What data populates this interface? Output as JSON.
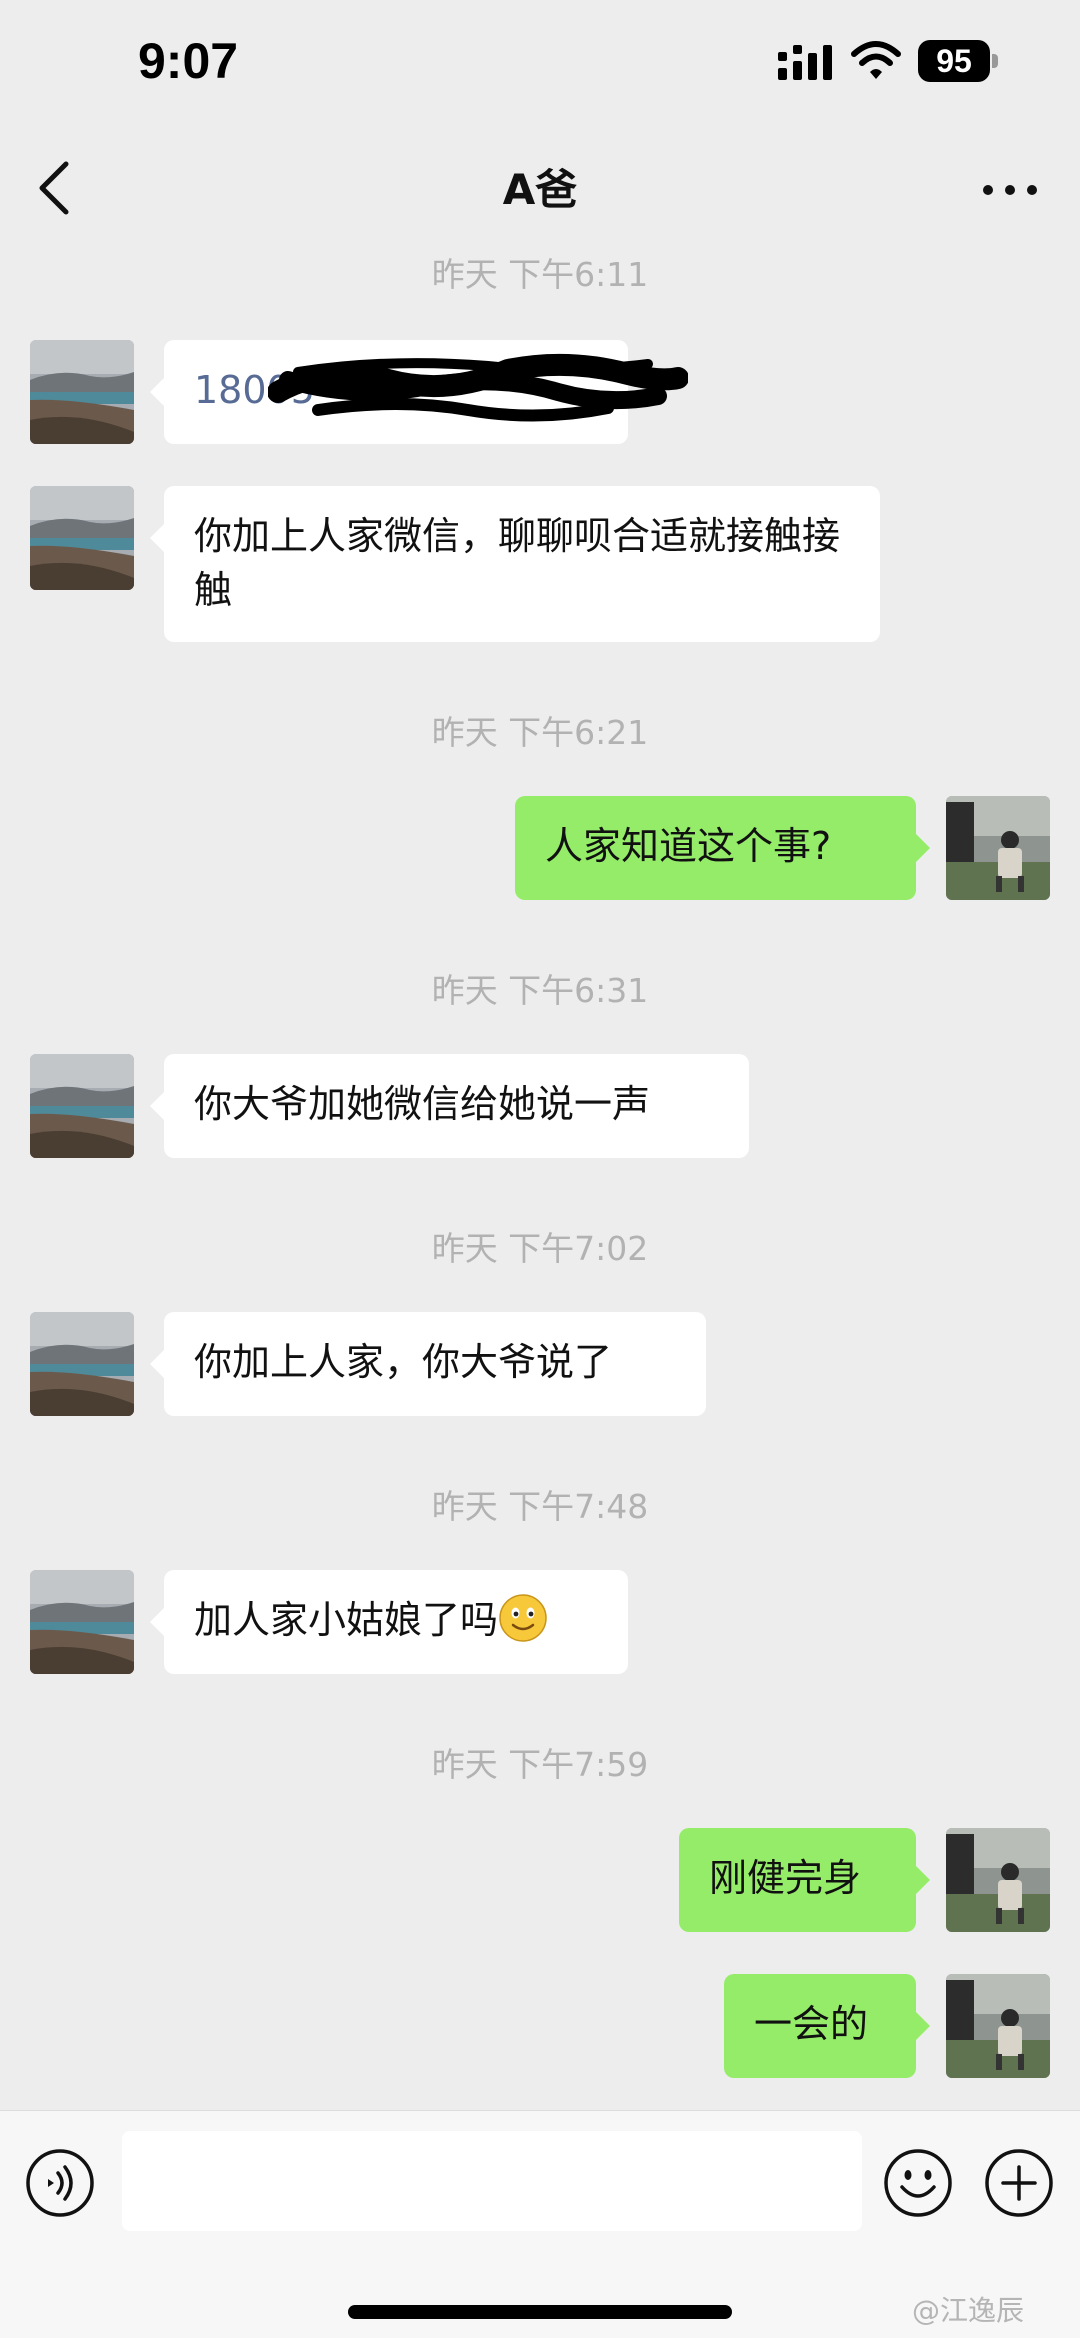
{
  "status_bar": {
    "time": "9:07",
    "battery": "95"
  },
  "nav": {
    "title": "A爸"
  },
  "messages": [
    {
      "type": "time",
      "text": "昨天 下午6:11"
    },
    {
      "type": "msg",
      "side": "left",
      "text": "18005",
      "style": "phone-redacted"
    },
    {
      "type": "msg",
      "side": "left",
      "text": "你加上人家微信，聊聊呗合适就接触接触"
    },
    {
      "type": "time",
      "text": "昨天 下午6:21"
    },
    {
      "type": "msg",
      "side": "right",
      "text": "人家知道这个事?"
    },
    {
      "type": "time",
      "text": "昨天 下午6:31"
    },
    {
      "type": "msg",
      "side": "left",
      "text": "你大爷加她微信给她说一声"
    },
    {
      "type": "time",
      "text": "昨天 下午7:02"
    },
    {
      "type": "msg",
      "side": "left",
      "text": "你加上人家，你大爷说了"
    },
    {
      "type": "time",
      "text": "昨天 下午7:48"
    },
    {
      "type": "msg",
      "side": "left",
      "text": "加人家小姑娘了吗",
      "emoji": "smile-emoji"
    },
    {
      "type": "time",
      "text": "昨天 下午7:59"
    },
    {
      "type": "msg",
      "side": "right",
      "text": "刚健完身"
    },
    {
      "type": "msg",
      "side": "right",
      "text": "一会的"
    }
  ],
  "input_bar": {
    "placeholder": "",
    "icons": [
      "voice-icon",
      "emoji-icon",
      "add-icon"
    ]
  },
  "watermark": "@江逸辰",
  "colors": {
    "background": "#ededed",
    "outgoing_bubble": "#95ec69",
    "incoming_bubble": "#ffffff",
    "timestamp": "#b2b2b2",
    "link": "#576b95"
  }
}
